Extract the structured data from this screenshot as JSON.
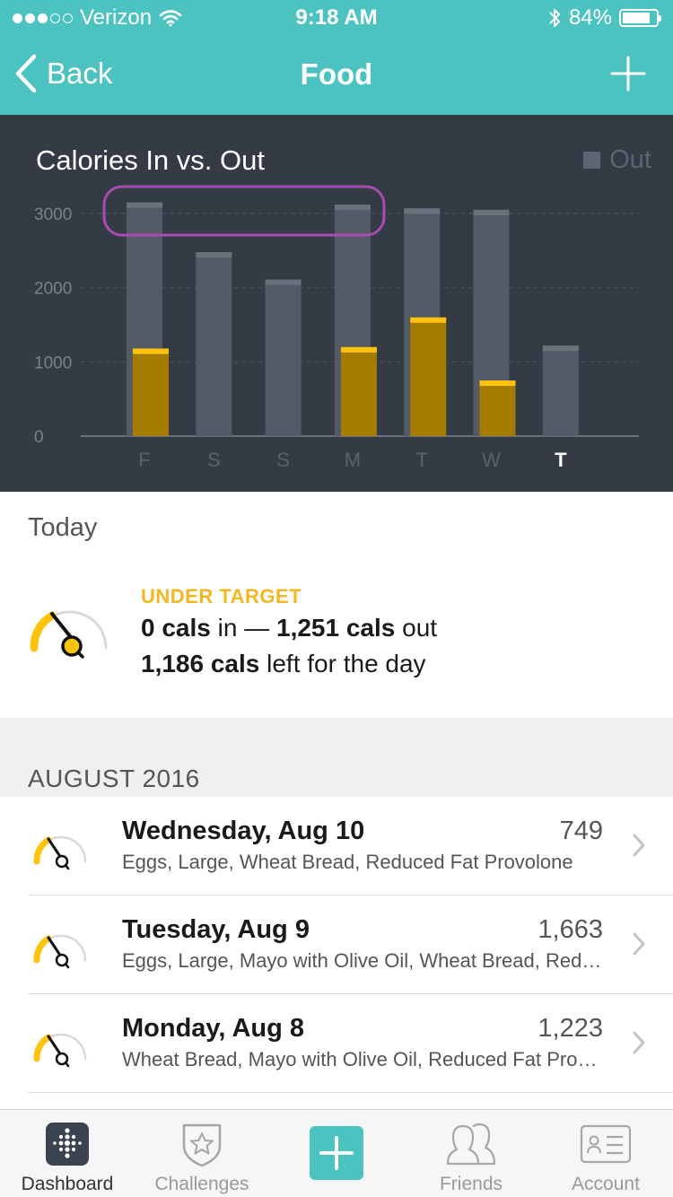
{
  "status_bar": {
    "carrier": "Verizon",
    "time": "9:18 AM",
    "battery": "84%",
    "battery_level": 0.84
  },
  "nav": {
    "back_label": "Back",
    "title": "Food"
  },
  "chart_data": {
    "type": "bar",
    "title": "Calories In vs. Out",
    "legend": [
      "Out"
    ],
    "categories": [
      "F",
      "S",
      "S",
      "M",
      "T",
      "W",
      "T"
    ],
    "highlighted_category_index": 6,
    "series": [
      {
        "name": "Out",
        "values": [
          3150,
          2480,
          2110,
          3120,
          3070,
          3050,
          1220
        ],
        "color": "#555b66"
      },
      {
        "name": "In",
        "values": [
          1180,
          0,
          0,
          1200,
          1600,
          750,
          0
        ],
        "color": "#a67c00"
      }
    ],
    "yticks": [
      0,
      1000,
      2000,
      3000
    ],
    "ylim": [
      0,
      3000
    ],
    "grid": true,
    "annotation": "purple rounded rectangle highlighting the tops of bars F, S, S, M near 3000",
    "colors": {
      "background": "#343b45",
      "out": "#555b66",
      "out_cap": "#6b717b",
      "in": "#a67c00",
      "in_cap": "#ffc20e",
      "annotation": "#a74cb5"
    }
  },
  "today": {
    "label": "Today",
    "status": "UNDER TARGET",
    "cals_in": "0 cals",
    "in_word": "in —",
    "cals_out": "1,251 cals",
    "out_word": "out",
    "cals_left": "1,186 cals",
    "left_suffix": "left for the day"
  },
  "month": {
    "label": "AUGUST 2016",
    "days": [
      {
        "title": "Wednesday, Aug 10",
        "calories": "749",
        "foods": "Eggs, Large, Wheat Bread, Reduced Fat Provolone"
      },
      {
        "title": "Tuesday, Aug 9",
        "calories": "1,663",
        "foods": "Eggs, Large, Mayo with Olive Oil, Wheat Bread, Reduced Fat"
      },
      {
        "title": "Monday, Aug 8",
        "calories": "1,223",
        "foods": "Wheat Bread, Mayo with Olive Oil, Reduced Fat Provolone"
      }
    ]
  },
  "tabs": [
    {
      "label": "Dashboard",
      "icon": "dashboard-icon",
      "active": true
    },
    {
      "label": "Challenges",
      "icon": "challenges-icon",
      "active": false
    },
    {
      "label": "",
      "icon": "add-icon",
      "active": false
    },
    {
      "label": "Friends",
      "icon": "friends-icon",
      "active": false
    },
    {
      "label": "Account",
      "icon": "account-icon",
      "active": false
    }
  ],
  "accent": "#4dc3c1",
  "warning": "#f5b623"
}
